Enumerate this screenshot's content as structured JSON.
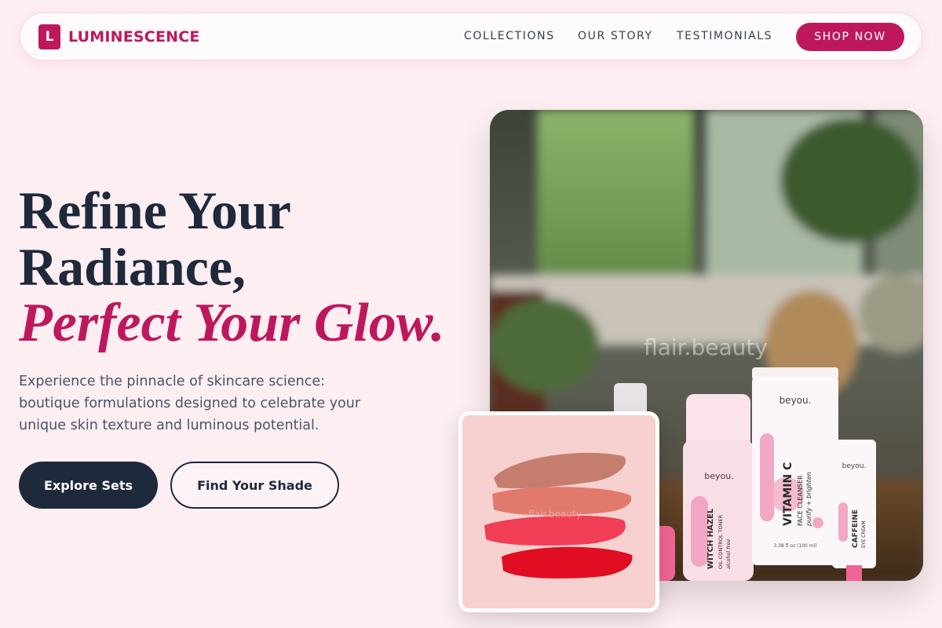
{
  "brand": {
    "logo_letter": "L",
    "name": "LUMINESCENCE"
  },
  "nav": {
    "links": [
      "COLLECTIONS",
      "OUR STORY",
      "TESTIMONIALS"
    ],
    "cta": "SHOP NOW"
  },
  "hero": {
    "title_line1": "Refine Your",
    "title_line2": "Radiance,",
    "title_accent": "Perfect Your Glow.",
    "description": "Experience the pinnacle of skincare science: boutique formulations designed to celebrate your unique skin texture and luminous potential.",
    "primary_button": "Explore Sets",
    "secondary_button": "Find Your Shade"
  },
  "images": {
    "watermark": "flair.beauty",
    "swatch_watermark": "flair.beauty",
    "product_brand": "beyou.",
    "toner_name": "WITCH HAZEL",
    "toner_sub": "OIL CONTROL TONER",
    "toner_note": "alcohol free",
    "cleanser_name": "VITAMIN C",
    "cleanser_sub": "FACE CLEANSER",
    "cleanser_note": "purify + brighten",
    "cleanser_size": "3.38 fl oz (100 ml)",
    "eye_name": "CAFFEINE",
    "eye_sub": "EYE CREAM"
  },
  "colors": {
    "accent": "#be185d",
    "dark": "#1e293b",
    "background": "#fdeef2"
  }
}
